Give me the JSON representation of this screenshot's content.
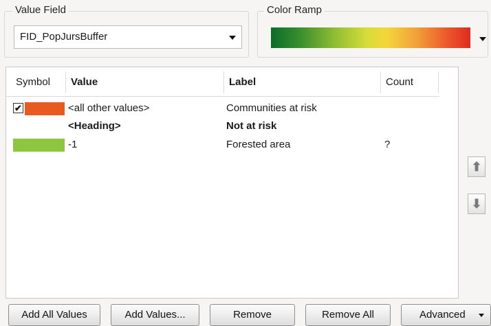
{
  "value_field": {
    "group_label": "Value Field",
    "selected": "FID_PopJursBuffer"
  },
  "color_ramp": {
    "group_label": "Color Ramp"
  },
  "table": {
    "headers": {
      "symbol": "Symbol",
      "value": "Value",
      "label": "Label",
      "count": "Count"
    },
    "rows": [
      {
        "checked": true,
        "check_glyph": "✔",
        "swatch_color": "#e85a20",
        "value": "<all other values>",
        "label": "Communities at risk",
        "count": ""
      },
      {
        "heading": true,
        "value": "<Heading>",
        "label": "Not at risk",
        "count": ""
      },
      {
        "swatch_color": "#8dc63f",
        "value": "-1",
        "label": "Forested area",
        "count": "?"
      }
    ]
  },
  "side_buttons": {
    "up_icon": "🡑",
    "down_icon": "🡓",
    "up_glyph": "⬆",
    "down_glyph": "⬇"
  },
  "buttons": {
    "add_all_values": "Add All Values",
    "add_values": "Add Values...",
    "remove": "Remove",
    "remove_all": "Remove All",
    "advanced": "Advanced"
  }
}
